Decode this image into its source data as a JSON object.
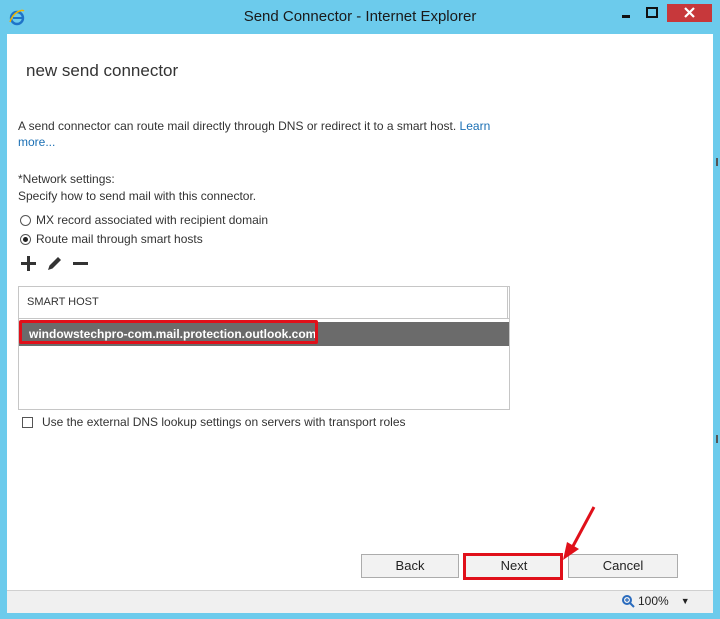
{
  "window": {
    "title": "Send Connector - Internet Explorer",
    "icon": "ie-icon",
    "controls": [
      "minimize-icon",
      "maximize-icon",
      "close-icon"
    ]
  },
  "page": {
    "title": "new send connector",
    "description": "A send connector can route mail directly through DNS or redirect it to a smart host.",
    "learn_more": "Learn more...",
    "network_label": "*Network settings:",
    "network_hint": "Specify how to send mail with this connector.",
    "radio_mx": "MX record associated with recipient domain",
    "radio_smart": "Route mail through smart hosts",
    "radio_selected": "smart"
  },
  "toolbar": {
    "icons": [
      "add-icon",
      "edit-icon",
      "remove-icon"
    ]
  },
  "grid": {
    "header": "SMART HOST",
    "rows": [
      "windowstechpro-com.mail.protection.outlook.com"
    ],
    "selected_index": 0
  },
  "checkbox": {
    "label": "Use the external DNS lookup settings on servers with transport roles",
    "checked": false
  },
  "buttons": {
    "back": "Back",
    "next": "Next",
    "cancel": "Cancel"
  },
  "statusbar": {
    "zoom": "100%"
  },
  "colors": {
    "frame": "#6ccbec",
    "close": "#c7383b",
    "highlight": "#e0101a",
    "selected_row": "#6b6b6b",
    "link": "#1a6fb4"
  }
}
